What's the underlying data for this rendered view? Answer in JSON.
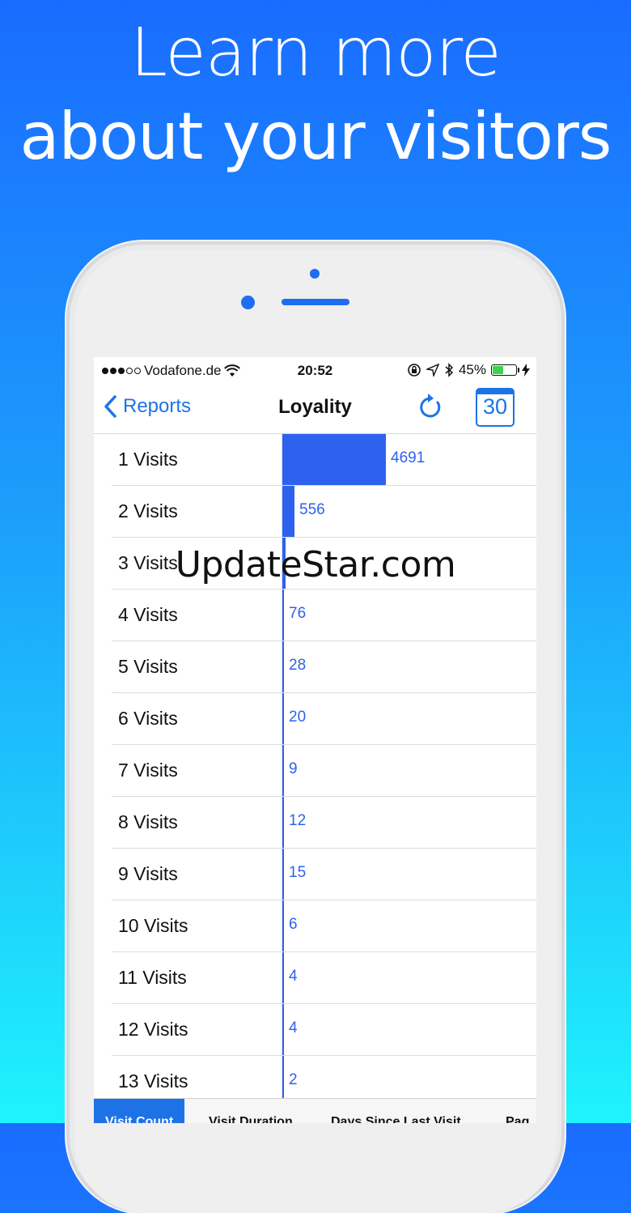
{
  "promo": {
    "line1": "Learn more",
    "line2": "about your visitors"
  },
  "status": {
    "carrier": "Vodafone.de",
    "time": "20:52",
    "battery": "45%",
    "battery_level": 0.45
  },
  "nav": {
    "back_label": "Reports",
    "title": "Loyality",
    "calendar_day": "30"
  },
  "chart_data": {
    "type": "bar",
    "orientation": "horizontal",
    "categories": [
      "1 Visits",
      "2 Visits",
      "3 Visits",
      "4 Visits",
      "5 Visits",
      "6 Visits",
      "7 Visits",
      "8 Visits",
      "9 Visits",
      "10 Visits",
      "11 Visits",
      "12 Visits",
      "13 Visits"
    ],
    "values": [
      4691,
      556,
      141,
      76,
      28,
      20,
      9,
      12,
      15,
      6,
      4,
      4,
      2
    ],
    "value_labels": [
      "4691",
      "556",
      "",
      "76",
      "28",
      "20",
      "9",
      "12",
      "15",
      "6",
      "4",
      "4",
      "2"
    ],
    "bar_color": "#2e62ee"
  },
  "tabs": [
    {
      "label": "Visit Count",
      "active": true
    },
    {
      "label": "Visit Duration",
      "active": false
    },
    {
      "label": "Days Since Last Visit",
      "active": false
    },
    {
      "label": "Pag",
      "active": false
    }
  ],
  "watermark": "UpdateStar.com",
  "colors": {
    "accent": "#1d73e6",
    "battery": "#3dd34a"
  }
}
